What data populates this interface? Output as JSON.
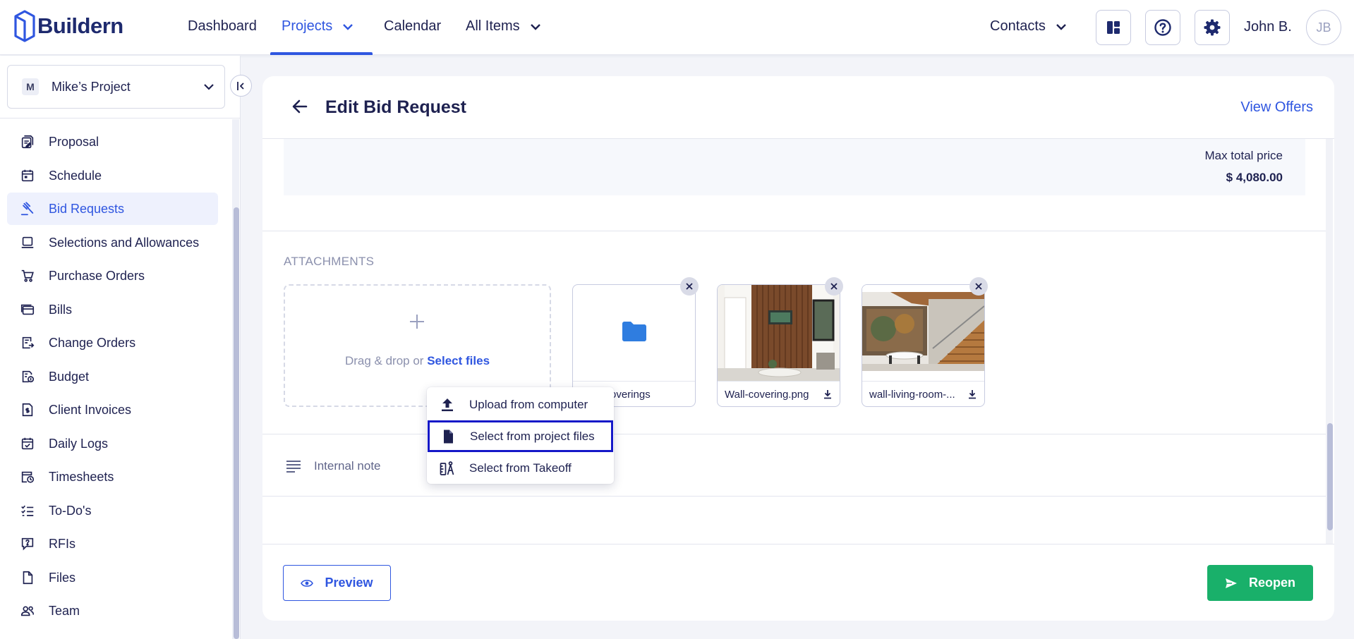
{
  "app": {
    "name": "Buildern"
  },
  "nav": {
    "dashboard": "Dashboard",
    "projects": "Projects",
    "calendar": "Calendar",
    "all_items": "All Items",
    "contacts": "Contacts"
  },
  "user": {
    "name": "John B.",
    "initials": "JB"
  },
  "sidebar": {
    "project_badge": "M",
    "project_name": "Mike’s Project",
    "items": [
      {
        "label": "Proposal",
        "icon": "proposal-icon"
      },
      {
        "label": "Schedule",
        "icon": "calendar-icon"
      },
      {
        "label": "Bid Requests",
        "icon": "gavel-icon",
        "active": true
      },
      {
        "label": "Selections and Allowances",
        "icon": "selections-icon"
      },
      {
        "label": "Purchase Orders",
        "icon": "cart-icon"
      },
      {
        "label": "Bills",
        "icon": "bills-icon"
      },
      {
        "label": "Change Orders",
        "icon": "change-orders-icon"
      },
      {
        "label": "Budget",
        "icon": "budget-icon"
      },
      {
        "label": "Client Invoices",
        "icon": "invoice-icon"
      },
      {
        "label": "Daily Logs",
        "icon": "daily-log-icon"
      },
      {
        "label": "Timesheets",
        "icon": "timesheet-icon"
      },
      {
        "label": "To-Do's",
        "icon": "todo-icon"
      },
      {
        "label": "RFIs",
        "icon": "rfi-icon"
      },
      {
        "label": "Files",
        "icon": "file-icon"
      },
      {
        "label": "Team",
        "icon": "team-icon"
      }
    ]
  },
  "page": {
    "title": "Edit Bid Request",
    "view_offers": "View Offers",
    "max_total_price_label": "Max total price",
    "max_total_price_value": "$ 4,080.00",
    "attachments_label": "ATTACHMENTS",
    "dropzone_text": "Drag & drop or ",
    "dropzone_link": "Select files",
    "files": [
      {
        "name": "overings",
        "type": "folder"
      },
      {
        "name": "Wall-covering.png",
        "type": "image"
      },
      {
        "name": "wall-living-room-...",
        "type": "image"
      }
    ],
    "internal_note": "Internal note",
    "preview_label": "Preview",
    "reopen_label": "Reopen"
  },
  "upload_menu": {
    "items": [
      {
        "label": "Upload from computer",
        "icon": "upload-icon"
      },
      {
        "label": "Select from project files",
        "icon": "document-icon"
      },
      {
        "label": "Select from Takeoff",
        "icon": "takeoff-icon"
      }
    ]
  },
  "colors": {
    "primary": "#2f56e0",
    "navy": "#1e2150",
    "success": "#19b06a",
    "focus_outline": "#1518c8"
  }
}
